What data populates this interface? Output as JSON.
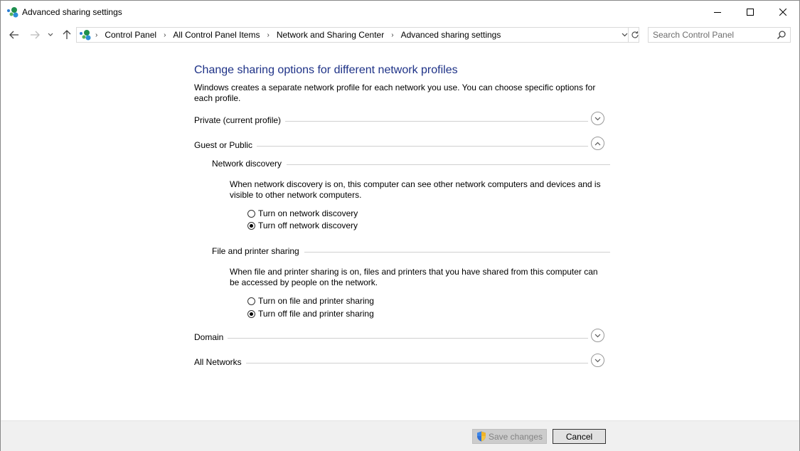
{
  "window": {
    "title": "Advanced sharing settings"
  },
  "address": {
    "breadcrumbs": [
      "Control Panel",
      "All Control Panel Items",
      "Network and Sharing Center",
      "Advanced sharing settings"
    ]
  },
  "search": {
    "placeholder": "Search Control Panel"
  },
  "main": {
    "title": "Change sharing options for different network profiles",
    "description": "Windows creates a separate network profile for each network you use. You can choose specific options for each profile.",
    "profiles": {
      "private": {
        "label": "Private (current profile)",
        "expanded": false
      },
      "guest": {
        "label": "Guest or Public",
        "expanded": true
      },
      "domain": {
        "label": "Domain",
        "expanded": false
      },
      "all": {
        "label": "All Networks",
        "expanded": false
      }
    },
    "network_discovery": {
      "heading": "Network discovery",
      "description": "When network discovery is on, this computer can see other network computers and devices and is visible to other network computers.",
      "option_on": "Turn on network discovery",
      "option_off": "Turn off network discovery",
      "selected": "off"
    },
    "file_sharing": {
      "heading": "File and printer sharing",
      "description": "When file and printer sharing is on, files and printers that you have shared from this computer can be accessed by people on the network.",
      "option_on": "Turn on file and printer sharing",
      "option_off": "Turn off file and printer sharing",
      "selected": "off"
    }
  },
  "footer": {
    "save_label": "Save changes",
    "cancel_label": "Cancel"
  },
  "colors": {
    "title_blue": "#1e3287",
    "footer_bg": "#f0f0f0"
  }
}
